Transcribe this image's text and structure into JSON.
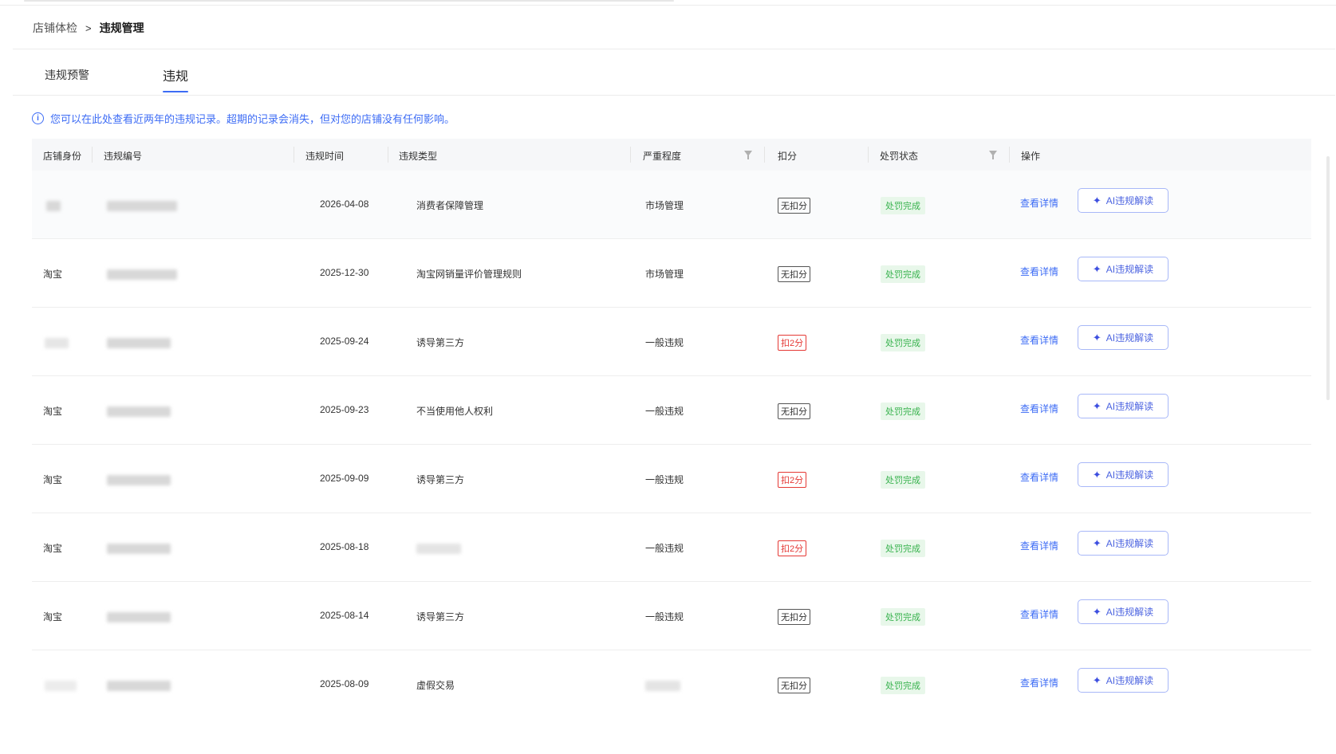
{
  "breadcrumb": {
    "home": "店铺体检",
    "separator": ">",
    "current": "违规管理"
  },
  "tabs": [
    {
      "label": "违规预警"
    },
    {
      "label": "违规"
    }
  ],
  "notice": "您可以在此处查看近两年的违规记录。超期的记录会消失，但对您的店铺没有任何影响。",
  "table": {
    "headers": {
      "identity": "店铺身份",
      "number": "违规编号",
      "time": "违规时间",
      "type": "违规类型",
      "severity": "严重程度",
      "deduction": "扣分",
      "status": "处罚状态",
      "action": "操作"
    },
    "rows": [
      {
        "identity": "",
        "time": "2026-04-08",
        "type": "消费者保障管理",
        "severity": "市场管理",
        "deduction": "无扣分",
        "deduction_kind": "none",
        "status": "处罚完成",
        "detail": "查看详情",
        "ai": "AI违规解读"
      },
      {
        "identity": "淘宝",
        "time": "2025-12-30",
        "type": "淘宝网销量评价管理规则",
        "severity": "市场管理",
        "deduction": "无扣分",
        "deduction_kind": "none",
        "status": "处罚完成",
        "detail": "查看详情",
        "ai": "AI违规解读"
      },
      {
        "identity": "",
        "time": "2025-09-24",
        "type": "诱导第三方",
        "severity": "一般违规",
        "deduction": "扣2分",
        "deduction_kind": "red",
        "status": "处罚完成",
        "detail": "查看详情",
        "ai": "AI违规解读"
      },
      {
        "identity": "淘宝",
        "time": "2025-09-23",
        "type": "不当使用他人权利",
        "severity": "一般违规",
        "deduction": "无扣分",
        "deduction_kind": "none",
        "status": "处罚完成",
        "detail": "查看详情",
        "ai": "AI违规解读"
      },
      {
        "identity": "淘宝",
        "time": "2025-09-09",
        "type": "诱导第三方",
        "severity": "一般违规",
        "deduction": "扣2分",
        "deduction_kind": "red",
        "status": "处罚完成",
        "detail": "查看详情",
        "ai": "AI违规解读"
      },
      {
        "identity": "淘宝",
        "time": "2025-08-18",
        "type": "",
        "severity": "一般违规",
        "deduction": "扣2分",
        "deduction_kind": "red",
        "status": "处罚完成",
        "detail": "查看详情",
        "ai": "AI违规解读"
      },
      {
        "identity": "淘宝",
        "time": "2025-08-14",
        "type": "诱导第三方",
        "severity": "一般违规",
        "deduction": "无扣分",
        "deduction_kind": "none",
        "status": "处罚完成",
        "detail": "查看详情",
        "ai": "AI违规解读"
      },
      {
        "identity": "",
        "time": "2025-08-09",
        "type": "虚假交易",
        "severity": "",
        "deduction": "无扣分",
        "deduction_kind": "none",
        "status": "处罚完成",
        "detail": "查看详情",
        "ai": "AI违规解读"
      }
    ]
  },
  "colors": {
    "accent": "#3d6cf5",
    "danger": "#e53935",
    "success": "#37b24d"
  },
  "icons": {
    "info": "info-circle-icon",
    "filter": "filter-icon",
    "sparkle": "sparkle-icon"
  }
}
